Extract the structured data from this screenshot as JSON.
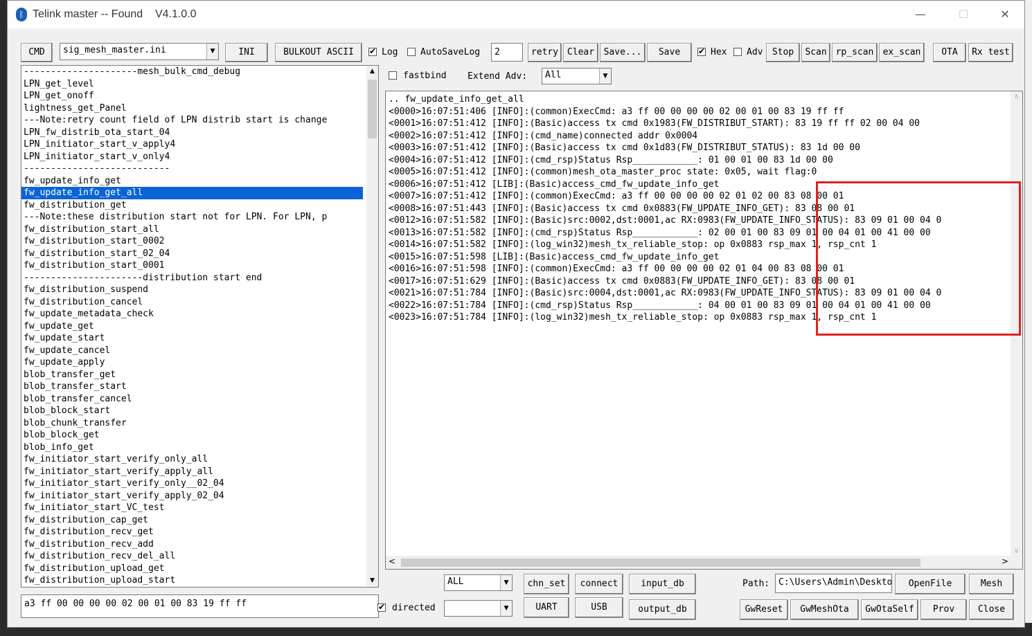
{
  "window": {
    "title": "Telink master -- Found    V4.1.0.0",
    "icon": "bluetooth-icon",
    "minimize": "—",
    "maximize": "☐",
    "close": "✕"
  },
  "toolbar": {
    "cmd": "CMD",
    "ini_file": "sig_mesh_master.ini",
    "ini": "INI",
    "bulkout": "BULKOUT ASCII",
    "log": "Log",
    "autosave": "AutoSaveLog",
    "autosave_count": "2",
    "retry": "retry",
    "clear": "Clear",
    "save_as": "Save...",
    "save": "Save",
    "hex": "Hex",
    "adv": "Adv",
    "stop": "Stop",
    "scan": "Scan",
    "rp_scan": "rp_scan",
    "ex_scan": "ex_scan",
    "ota": "OTA",
    "rx_test": "Rx test",
    "fastbind": "fastbind",
    "extend_adv_label": "Extend Adv:",
    "extend_adv_value": "All"
  },
  "command_list": {
    "items": [
      "---------------------mesh_bulk_cmd_debug",
      "LPN_get_level",
      "LPN_get_onoff",
      "lightness_get_Panel",
      "---Note:retry count field of LPN distrib start is change",
      "LPN_fw_distrib_ota_start_04",
      "LPN_initiator_start_v_apply4",
      "LPN_initiator_start_v_only4",
      "---------------------------",
      "fw_update_info_get",
      "fw_update_info_get_all",
      "fw_distribution_get",
      "---Note:these distribution start not for LPN. For LPN, p",
      "fw_distribution_start_all",
      "fw_distribution_start_0002",
      "fw_distribution_start_02_04",
      "fw_distribution_start_0001",
      "----------------------distribution start end",
      "fw_distribution_suspend",
      "fw_distribution_cancel",
      "fw_update_metadata_check",
      "fw_update_get",
      "fw_update_start",
      "fw_update_cancel",
      "fw_update_apply",
      "blob_transfer_get",
      "blob_transfer_start",
      "blob_transfer_cancel",
      "blob_block_start",
      "blob_chunk_transfer",
      "blob_block_get",
      "blob_info_get",
      "fw_initiator_start_verify_only_all",
      "fw_initiator_start_verify_apply_all",
      "fw_initiator_start_verify_only__02_04",
      "fw_initiator_start_verify_apply_02_04",
      "fw_initiator_start_VC_test",
      "fw_distribution_cap_get",
      "fw_distribution_recv_get",
      "fw_distribution_recv_add",
      "fw_distribution_recv_del_all",
      "fw_distribution_upload_get",
      "fw_distribution_upload_start"
    ],
    "selected_index": 10
  },
  "command_input": "a3 ff 00 00 00 00 02 00 01 00 83 19 ff ff",
  "log": {
    "lines": [
      ".. fw_update_info_get_all",
      "<0000>16:07:51:406 [INFO]:(common)ExecCmd: a3 ff 00 00 00 00 02 00 01 00 83 19 ff ff",
      "<0001>16:07:51:412 [INFO]:(Basic)access tx cmd 0x1983(FW_DISTRIBUT_START): 83 19 ff ff 02 00 04 00",
      "<0002>16:07:51:412 [INFO]:(cmd_name)connected addr 0x0004",
      "<0003>16:07:51:412 [INFO]:(Basic)access tx cmd 0x1d83(FW_DISTRIBUT_STATUS): 83 1d 00 00",
      "<0004>16:07:51:412 [INFO]:(cmd_rsp)Status Rsp____________: 01 00 01 00 83 1d 00 00",
      "<0005>16:07:51:412 [INFO]:(common)mesh_ota_master_proc state: 0x05, wait flag:0",
      "<0006>16:07:51:412 [LIB]:(Basic)access_cmd_fw_update_info_get",
      "<0007>16:07:51:412 [INFO]:(common)ExecCmd: a3 ff 00 00 00 00 02 01 02 00 83 08 00 01",
      "<0008>16:07:51:443 [INFO]:(Basic)access tx cmd 0x0883(FW_UPDATE_INFO_GET): 83 08 00 01",
      "<0012>16:07:51:582 [INFO]:(Basic)src:0002,dst:0001,ac RX:0983(FW_UPDATE_INFO_STATUS): 83 09 01 00 04 0",
      "<0013>16:07:51:582 [INFO]:(cmd_rsp)Status Rsp____________: 02 00 01 00 83 09 01 00 04 01 00 41 00 00",
      "<0014>16:07:51:582 [INFO]:(log_win32)mesh_tx_reliable_stop: op 0x0883 rsp_max 1, rsp_cnt 1",
      "<0015>16:07:51:598 [LIB]:(Basic)access_cmd_fw_update_info_get",
      "<0016>16:07:51:598 [INFO]:(common)ExecCmd: a3 ff 00 00 00 00 02 01 04 00 83 08 00 01",
      "<0017>16:07:51:629 [INFO]:(Basic)access tx cmd 0x0883(FW_UPDATE_INFO_GET): 83 08 00 01",
      "<0021>16:07:51:784 [INFO]:(Basic)src:0004,dst:0001,ac RX:0983(FW_UPDATE_INFO_STATUS): 83 09 01 00 04 0",
      "<0022>16:07:51:784 [INFO]:(cmd_rsp)Status Rsp____________: 04 00 01 00 83 09 01 00 04 01 00 41 00 00",
      "<0023>16:07:51:784 [INFO]:(log_win32)mesh_tx_reliable_stop: op 0x0883 rsp_max 1, rsp_cnt 1"
    ]
  },
  "bottom": {
    "all_combo": "ALL",
    "directed": "directed",
    "directed_combo": "",
    "chn_set": "chn_set",
    "connect": "connect",
    "input_db": "input_db",
    "uart": "UART",
    "usb": "USB",
    "output_db": "output_db",
    "path_label": "Path:",
    "path_value": "C:\\Users\\Admin\\Desktop",
    "openfile": "OpenFile",
    "mesh": "Mesh",
    "gwreset": "GwReset",
    "gwmeshota": "GwMeshOta",
    "gwotaself": "GwOtaSelf",
    "prov": "Prov",
    "close": "Close"
  },
  "colors": {
    "selection": "#0a64d8",
    "highlight_box": "#e02020"
  }
}
